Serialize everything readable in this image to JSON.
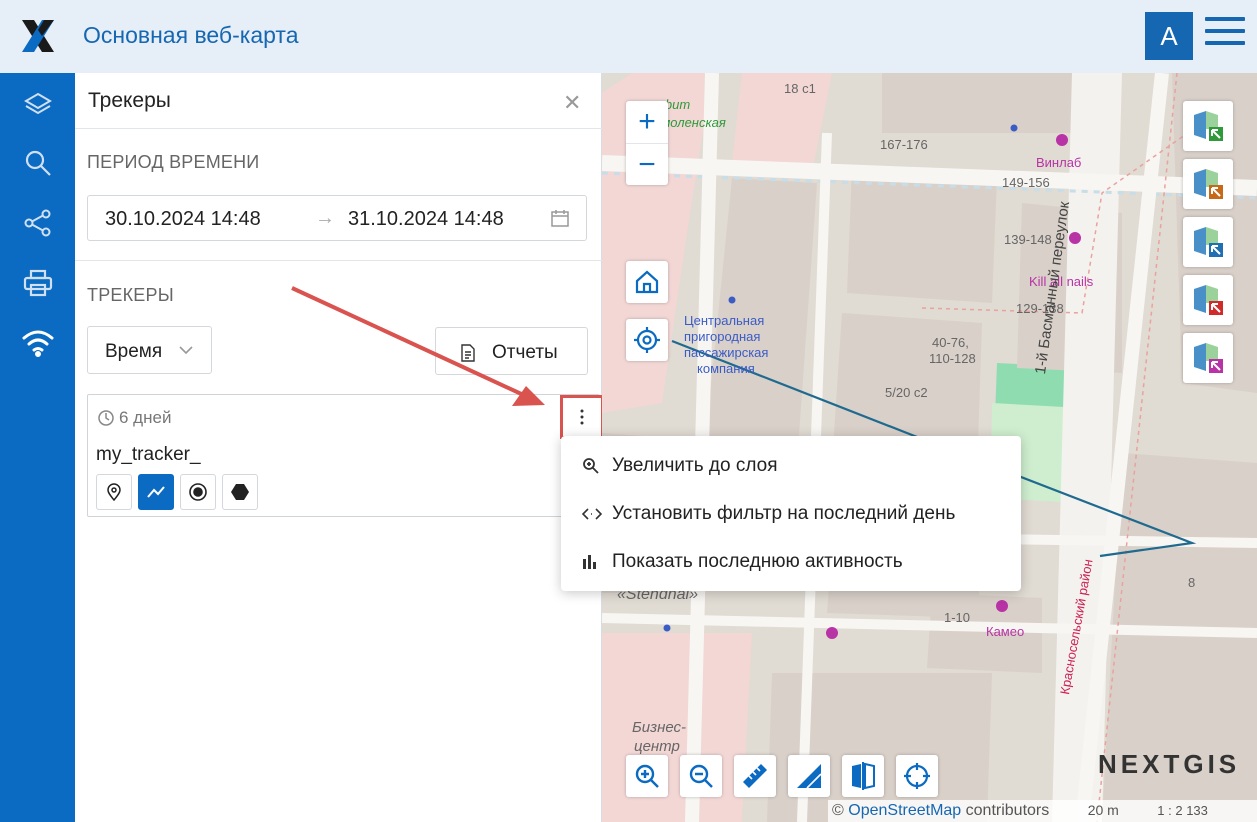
{
  "app": {
    "title": "Основная веб-карта",
    "avatar_letter": "A",
    "accent": "#0b6ac1"
  },
  "rail": {
    "items": [
      {
        "icon": "layers-icon"
      },
      {
        "icon": "search-icon"
      },
      {
        "icon": "share-icon"
      },
      {
        "icon": "print-icon"
      },
      {
        "icon": "wifi-icon"
      }
    ]
  },
  "panel": {
    "title": "Трекеры",
    "period_label": "ПЕРИОД ВРЕМЕНИ",
    "date_start": "30.10.2024 14:48",
    "date_separator": "→",
    "date_end": "31.10.2024 14:48",
    "trackers_label": "ТРЕКЕРЫ",
    "sort_select": "Время",
    "reports_button": "Отчеты",
    "tracker": {
      "duration": "6 дней",
      "name": "my_tracker_",
      "display_modes": [
        "points-icon",
        "line-icon",
        "last-point-icon",
        "polygon-icon"
      ],
      "active_mode": "line-icon"
    }
  },
  "context_menu": {
    "items": [
      {
        "icon": "zoom-layer-icon",
        "label": "Увеличить до слоя"
      },
      {
        "icon": "filter-range-icon",
        "label": "Установить фильтр на последний день"
      },
      {
        "icon": "bar-chart-icon",
        "label": "Показать последнюю активность"
      }
    ]
  },
  "map": {
    "labels": {
      "l1": "18 c1",
      "l2": "167-176",
      "l3": "Винлаб",
      "l4": "149-156",
      "l5": "139-148",
      "l6": "Kill all nails",
      "l7": "129-138",
      "l8": "40-76,",
      "l9": "110-128",
      "l10": "5/20 c2",
      "l11": "Центральная",
      "l12": "пригородная",
      "l13": "пассажирская",
      "l14": "компания",
      "l15": "1-й Басманный переулок",
      "l16": "Красносельский район",
      "l17": "8",
      "l18": "1-10",
      "l19": "Камео",
      "l20": "«Stendhal»",
      "l21": "Бизнес-",
      "l22": "центр",
      "l23": "Смоленская",
      "l24": "офит"
    },
    "attribution_prefix": "©",
    "attribution_link": "OpenStreetMap",
    "attribution_suffix": "contributors",
    "scale": "20 m",
    "ratio": "1 : 2 133",
    "brand": "NEXTGIS"
  }
}
